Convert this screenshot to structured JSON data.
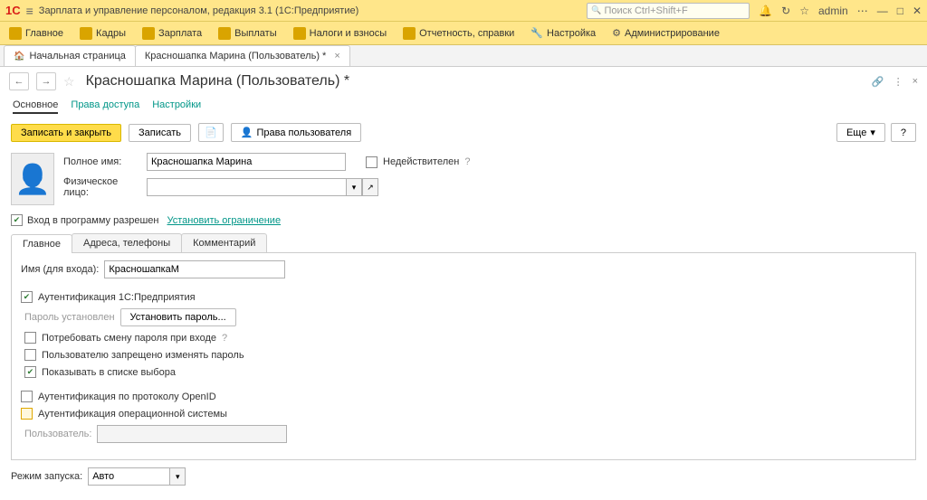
{
  "app": {
    "title": "Зарплата и управление персоналом, редакция 3.1  (1С:Предприятие)",
    "search_placeholder": "Поиск Ctrl+Shift+F",
    "user": "admin"
  },
  "menu": {
    "items": [
      {
        "label": "Главное"
      },
      {
        "label": "Кадры"
      },
      {
        "label": "Зарплата"
      },
      {
        "label": "Выплаты"
      },
      {
        "label": "Налоги и взносы"
      },
      {
        "label": "Отчетность, справки"
      },
      {
        "label": "Настройка"
      },
      {
        "label": "Администрирование"
      }
    ]
  },
  "tabs": {
    "home": "Начальная страница",
    "current": "Красношапка Марина (Пользователь) *"
  },
  "page": {
    "title": "Красношапка Марина (Пользователь) *"
  },
  "subnav": {
    "main": "Основное",
    "rights": "Права доступа",
    "settings": "Настройки"
  },
  "actions": {
    "save_close": "Записать и закрыть",
    "save": "Записать",
    "user_rights": "Права пользователя",
    "more": "Еще",
    "help": "?"
  },
  "form": {
    "full_name_label": "Полное имя:",
    "full_name_value": "Красношапка Марина",
    "invalid_label": "Недействителен",
    "phys_person_label": "Физическое лицо:",
    "phys_person_value": "",
    "login_allowed_label": "Вход в программу разрешен",
    "set_restriction": "Установить ограничение"
  },
  "inner_tabs": {
    "main": "Главное",
    "addresses": "Адреса, телефоны",
    "comment": "Комментарий"
  },
  "main_tab": {
    "login_name_label": "Имя (для входа):",
    "login_name_value": "КрасношапкаМ",
    "auth_1c_label": "Аутентификация 1С:Предприятия",
    "password_set_label": "Пароль установлен",
    "set_password_btn": "Установить пароль...",
    "require_pwd_change": "Потребовать смену пароля при входе",
    "forbid_pwd_change": "Пользователю запрещено изменять пароль",
    "show_in_list": "Показывать в списке выбора",
    "auth_openid": "Аутентификация по протоколу OpenID",
    "auth_os": "Аутентификация операционной системы",
    "user_label": "Пользователь:",
    "user_value": "",
    "launch_mode_label": "Режим запуска:",
    "launch_mode_value": "Авто"
  }
}
